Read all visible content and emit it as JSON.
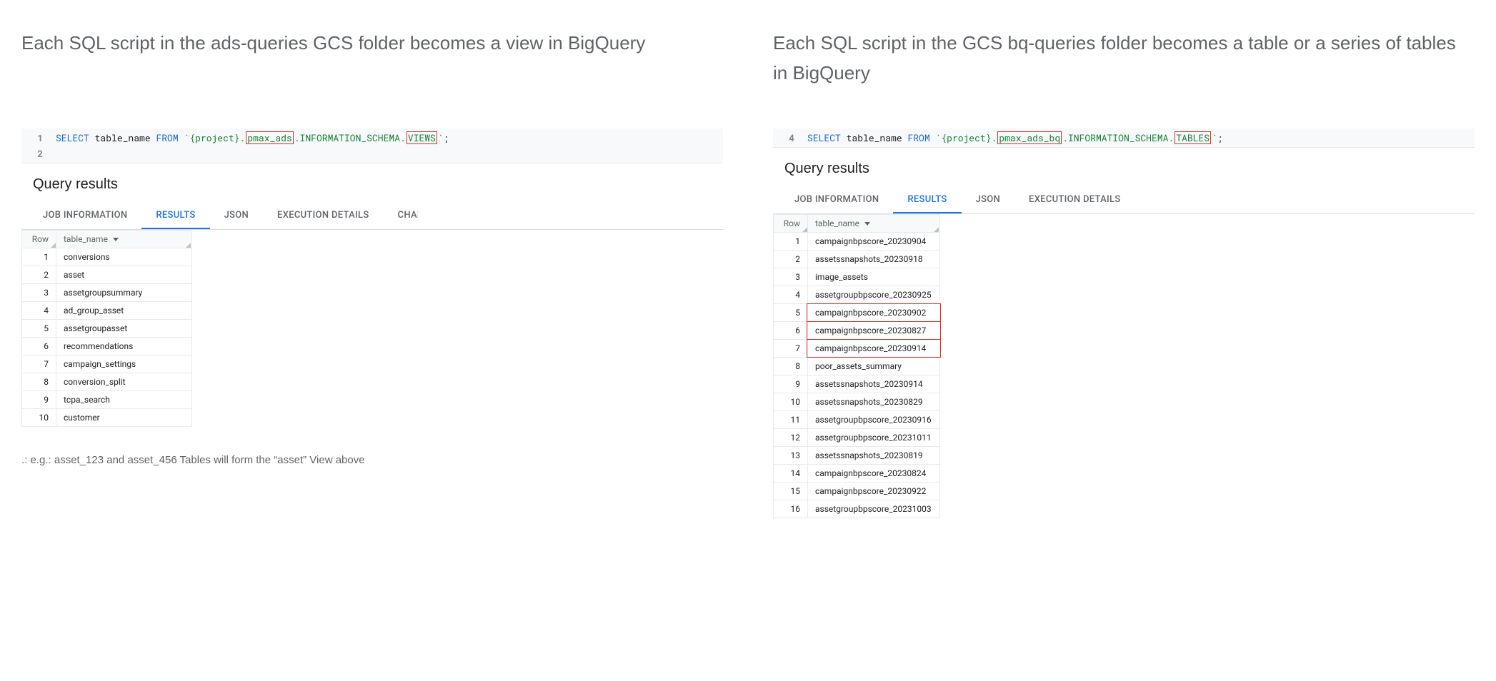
{
  "left": {
    "description": "Each SQL script in the ads-queries GCS folder becomes a view in BigQuery",
    "code": {
      "line_number": "1",
      "line_number2": "2",
      "select": "SELECT",
      "table_name": "table_name",
      "from": "FROM",
      "backtick1": "`",
      "project": "{project}",
      "dot1": ".",
      "dataset": "pmax_ads",
      "dot2": ".",
      "info_schema": "INFORMATION_SCHEMA",
      "dot3": ".",
      "target": "VIEWS",
      "backtick2": "`",
      "semi": ";"
    },
    "results_title": "Query results",
    "tabs": {
      "job_info": "JOB INFORMATION",
      "results": "RESULTS",
      "json": "JSON",
      "exec": "EXECUTION DETAILS",
      "chart": "CHART"
    },
    "headers": {
      "row": "Row",
      "name": "table_name"
    },
    "rows": [
      {
        "n": "1",
        "name": "conversions"
      },
      {
        "n": "2",
        "name": "asset"
      },
      {
        "n": "3",
        "name": "assetgroupsummary"
      },
      {
        "n": "4",
        "name": "ad_group_asset"
      },
      {
        "n": "5",
        "name": "assetgroupasset"
      },
      {
        "n": "6",
        "name": "recommendations"
      },
      {
        "n": "7",
        "name": "campaign_settings"
      },
      {
        "n": "8",
        "name": "conversion_split"
      },
      {
        "n": "9",
        "name": "tcpa_search"
      },
      {
        "n": "10",
        "name": "customer"
      }
    ],
    "footnote": ".: e.g.: asset_123 and asset_456 Tables will form the “asset” View above"
  },
  "right": {
    "description": "Each SQL script in the GCS bq-queries folder becomes a table or a series of tables in BigQuery",
    "code": {
      "line_number": "4",
      "select": "SELECT",
      "table_name": "table_name",
      "from": "FROM",
      "backtick1": "`",
      "project": "{project}",
      "dot1": ".",
      "dataset": "pmax_ads_bq",
      "dot2": ".",
      "info_schema": "INFORMATION_SCHEMA",
      "dot3": ".",
      "target": "TABLES",
      "backtick2": "`",
      "semi": ";"
    },
    "results_title": "Query results",
    "tabs": {
      "job_info": "JOB INFORMATION",
      "results": "RESULTS",
      "json": "JSON",
      "exec": "EXECUTION DETAILS"
    },
    "headers": {
      "row": "Row",
      "name": "table_name"
    },
    "rows": [
      {
        "n": "1",
        "name": "campaignbpscore_20230904"
      },
      {
        "n": "2",
        "name": "assetssnapshots_20230918"
      },
      {
        "n": "3",
        "name": "image_assets"
      },
      {
        "n": "4",
        "name": "assetgroupbpscore_20230925"
      },
      {
        "n": "5",
        "name": "campaignbpscore_20230902",
        "hl": true
      },
      {
        "n": "6",
        "name": "campaignbpscore_20230827",
        "hl": true
      },
      {
        "n": "7",
        "name": "campaignbpscore_20230914",
        "hl": true
      },
      {
        "n": "8",
        "name": "poor_assets_summary"
      },
      {
        "n": "9",
        "name": "assetssnapshots_20230914"
      },
      {
        "n": "10",
        "name": "assetssnapshots_20230829"
      },
      {
        "n": "11",
        "name": "assetgroupbpscore_20230916"
      },
      {
        "n": "12",
        "name": "assetgroupbpscore_20231011"
      },
      {
        "n": "13",
        "name": "assetssnapshots_20230819"
      },
      {
        "n": "14",
        "name": "campaignbpscore_20230824"
      },
      {
        "n": "15",
        "name": "campaignbpscore_20230922"
      },
      {
        "n": "16",
        "name": "assetgroupbpscore_20231003"
      }
    ]
  }
}
